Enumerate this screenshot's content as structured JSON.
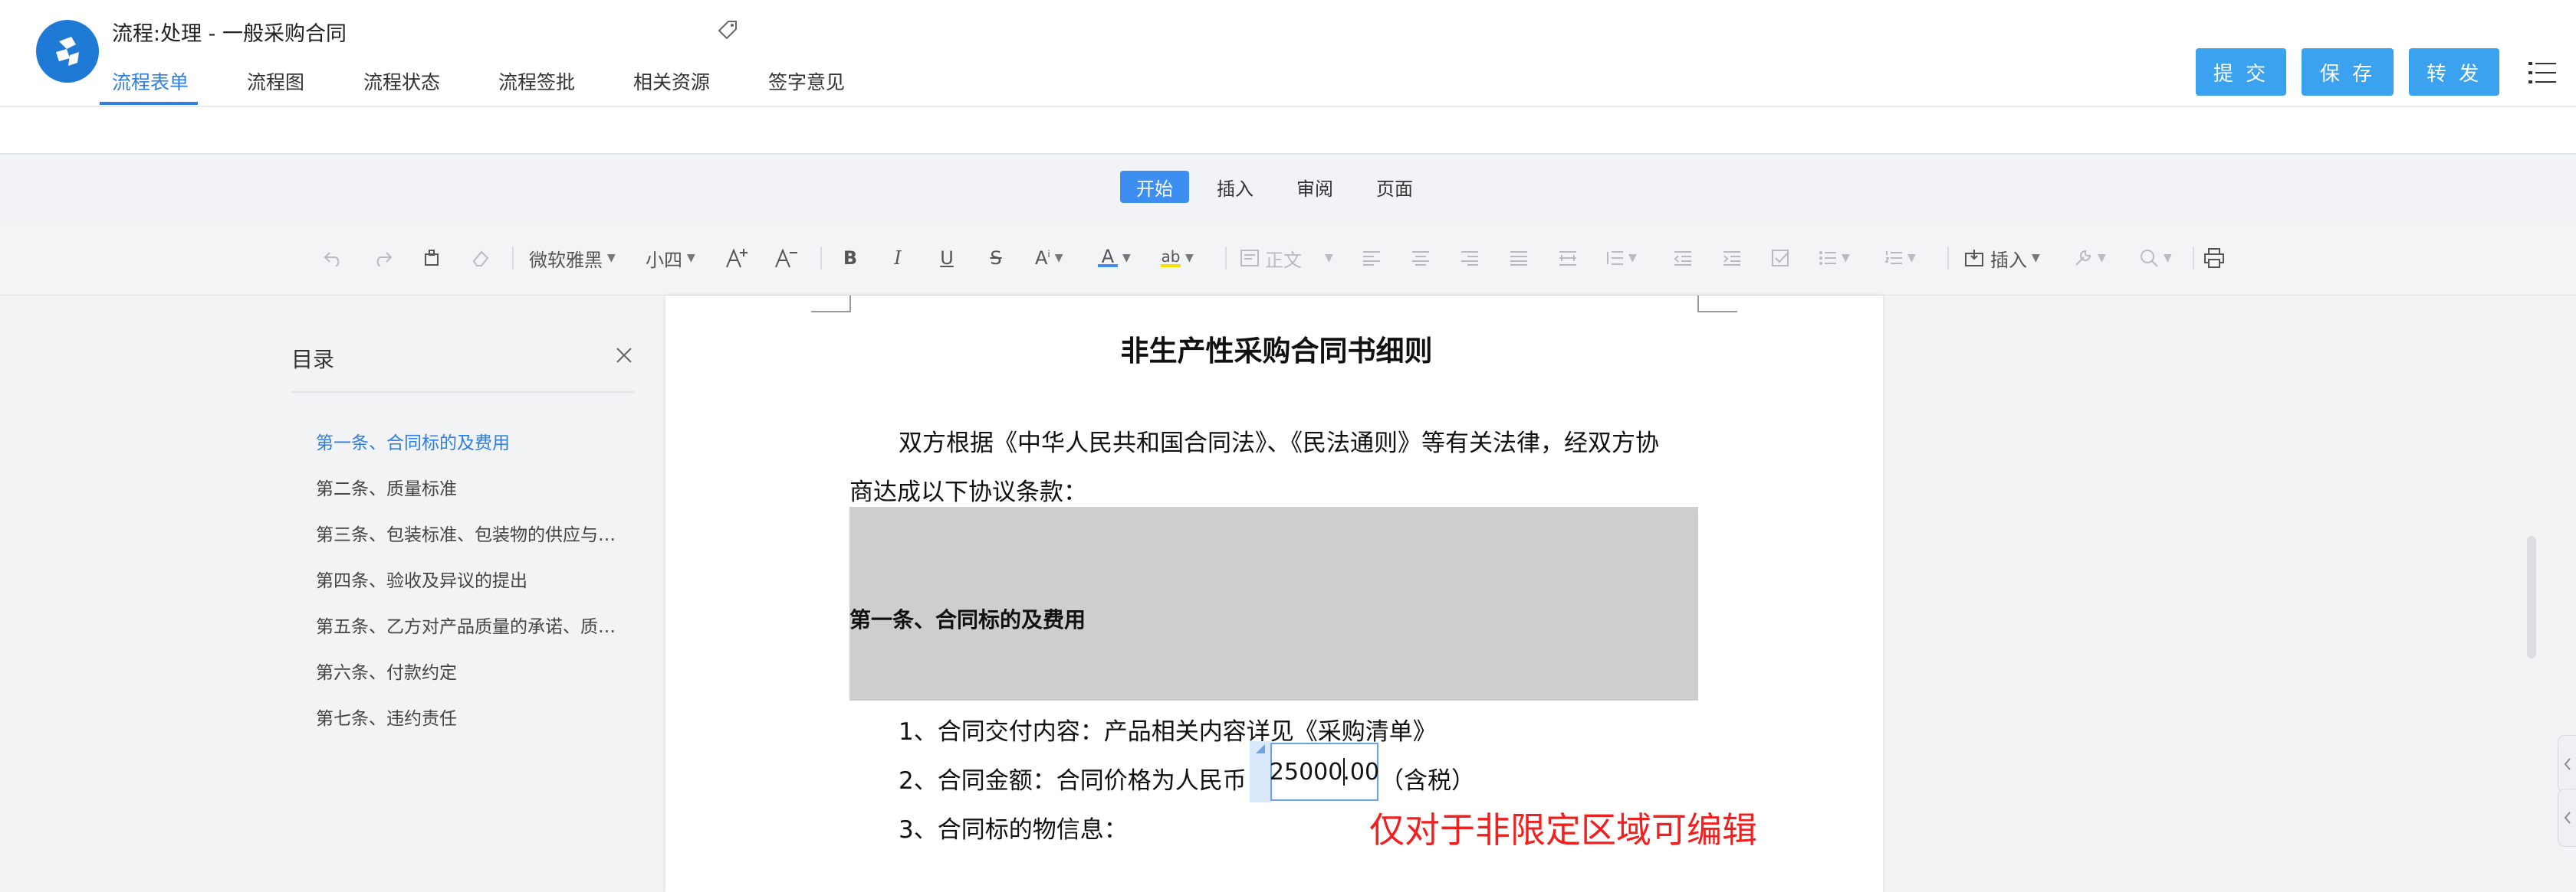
{
  "header": {
    "title": "流程:处理 - 一般采购合同",
    "tabs": [
      "流程表单",
      "流程图",
      "流程状态",
      "流程签批",
      "相关资源",
      "签字意见"
    ],
    "buttons": {
      "submit": "提 交",
      "save": "保 存",
      "forward": "转 发"
    }
  },
  "ribbon": {
    "tabs": [
      "开始",
      "插入",
      "审阅",
      "页面"
    ]
  },
  "toolbar": {
    "font_family": "微软雅黑",
    "font_size": "小四",
    "style": "正文",
    "insert": "插入",
    "accent_blue": "#3d8ef0",
    "highlight_color": "#f5e000"
  },
  "toc": {
    "title": "目录",
    "items": [
      "第一条、合同标的及费用",
      "第二条、质量标准",
      "第三条、包装标准、包装物的供应与…",
      "第四条、验收及异议的提出",
      "第五条、乙方对产品质量的承诺、质…",
      "第六条、付款约定",
      "第七条、违约责任"
    ]
  },
  "document": {
    "title": "非生产性采购合同书细则",
    "intro_line1": "双方根据《中华人民共和国合同法》、《民法通则》等有关法律，经双方协",
    "intro_line2": "商达成以下协议条款：",
    "section1": "第一条、合同标的及费用",
    "item1": "1、合同交付内容：产品相关内容详见《采购清单》",
    "item2_prefix": "2、合同金额：合同价格为人民币",
    "amount": "25000.00",
    "item2_suffix": "（含税）",
    "item3": "3、合同标的物信息：",
    "note": "仅对于非限定区域可编辑"
  }
}
